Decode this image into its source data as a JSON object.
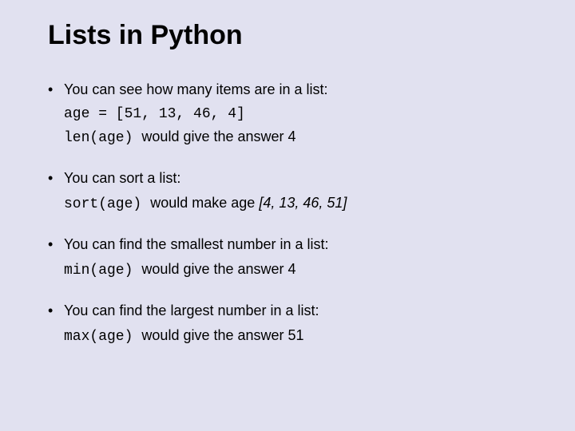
{
  "title": "Lists in Python",
  "items": [
    {
      "lead": "You can see how many items are in a list:",
      "code_line": "age = [51, 13, 46, 4]",
      "result_code": "len(age)",
      "result_text": " would give the answer 4",
      "result_italic": ""
    },
    {
      "lead": "You can sort a list:",
      "code_line": "",
      "result_code": "sort(age)",
      "result_text": " would make age ",
      "result_italic": "[4, 13, 46, 51]"
    },
    {
      "lead": "You can find the smallest number in a list:",
      "code_line": "",
      "result_code": "min(age)",
      "result_text": " would give the answer 4",
      "result_italic": ""
    },
    {
      "lead": "You can find the largest number in a list:",
      "code_line": "",
      "result_code": "max(age)",
      "result_text": " would give the answer 51",
      "result_italic": ""
    }
  ]
}
